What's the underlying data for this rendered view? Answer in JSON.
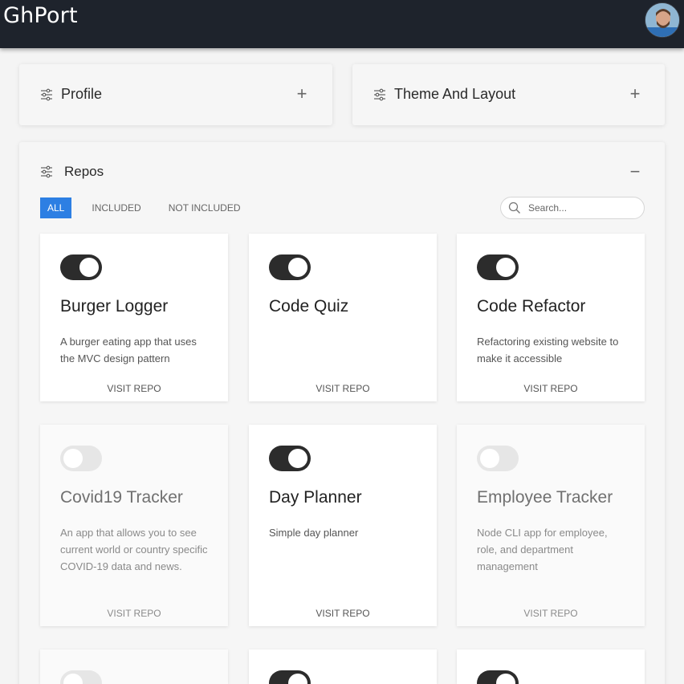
{
  "app": {
    "title": "GhPort"
  },
  "panels": {
    "profile": {
      "title": "Profile",
      "toggle": "+"
    },
    "theme": {
      "title": "Theme And Layout",
      "toggle": "+"
    },
    "repos": {
      "title": "Repos",
      "toggle": "−"
    }
  },
  "filters": {
    "tabs": [
      "ALL",
      "INCLUDED",
      "NOT INCLUDED"
    ],
    "active": "ALL"
  },
  "search": {
    "placeholder": "Search..."
  },
  "repos": [
    {
      "name": "Burger Logger",
      "description": "A burger eating app that uses the MVC design pattern",
      "included": true,
      "link": "VISIT REPO"
    },
    {
      "name": "Code Quiz",
      "description": "",
      "included": true,
      "link": "VISIT REPO"
    },
    {
      "name": "Code Refactor",
      "description": "Refactoring existing website to make it accessible",
      "included": true,
      "link": "VISIT REPO"
    },
    {
      "name": "Covid19 Tracker",
      "description": "An app that allows you to see current world or country specific COVID-19 data and news.",
      "included": false,
      "link": "VISIT REPO"
    },
    {
      "name": "Day Planner",
      "description": "Simple day planner",
      "included": true,
      "link": "VISIT REPO"
    },
    {
      "name": "Employee Tracker",
      "description": "Node CLI app for employee, role, and department management",
      "included": false,
      "link": "VISIT REPO"
    },
    {
      "name": "",
      "description": "",
      "included": false,
      "link": ""
    },
    {
      "name": "",
      "description": "",
      "included": true,
      "link": ""
    },
    {
      "name": "",
      "description": "",
      "included": true,
      "link": ""
    }
  ],
  "colors": {
    "topbar": "#1e232c",
    "accent": "#2d7fe3",
    "switch_on": "#2c2c2c",
    "switch_off": "#e6e6e6"
  },
  "icons": {
    "panel": "sliders-icon",
    "search": "search-icon"
  }
}
